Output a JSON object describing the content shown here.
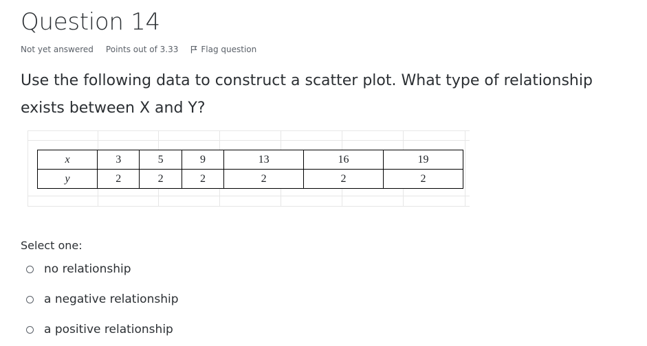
{
  "question": {
    "title": "Question 14",
    "status": "Not yet answered",
    "points": "Points out of 3.33",
    "flag_label": "Flag question",
    "text": "Use the following data to construct a scatter plot. What type of relationship exists between X and Y?"
  },
  "table": {
    "x_label": "x",
    "y_label": "y",
    "x_values": [
      "3",
      "5",
      "9",
      "13",
      "16",
      "19"
    ],
    "y_values": [
      "2",
      "2",
      "2",
      "2",
      "2",
      "2"
    ]
  },
  "answer": {
    "prompt": "Select one:",
    "options": [
      "no relationship",
      "a negative relationship",
      "a positive relationship"
    ]
  },
  "colors": {
    "text": "#2b2f33",
    "meta": "#5a6068",
    "grid": "#e6e6e6"
  },
  "icons": {
    "flag": "flag-icon",
    "radio": "radio-unchecked-icon"
  }
}
